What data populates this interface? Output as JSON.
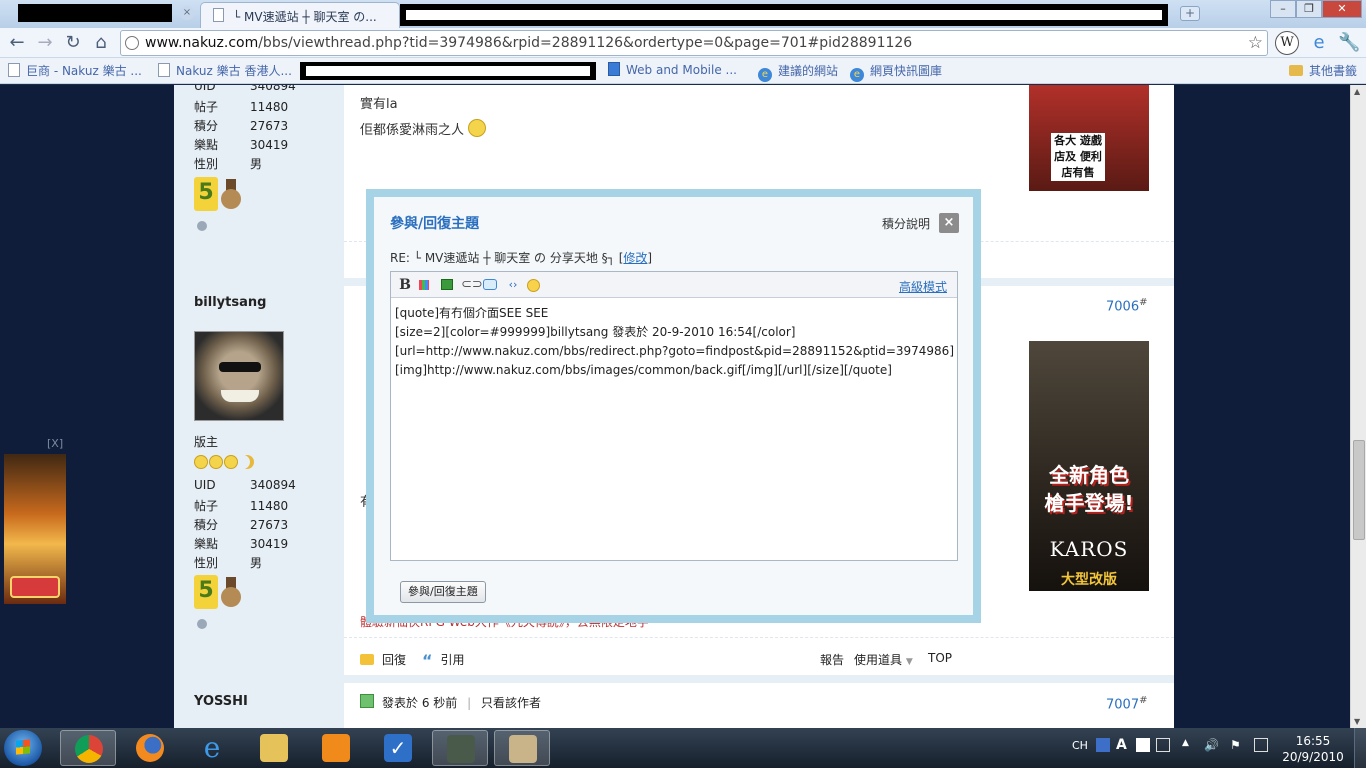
{
  "browser": {
    "tab_title": "└ MV速遞站 ┼ 聊天室 の...",
    "tab_close": "×",
    "new_tab": "+",
    "url_host": "www.nakuz.com",
    "url_path": "/bbs/viewthread.php?tid=3974986&rpid=28891126&ordertype=0&page=701#pid28891126",
    "window_controls": [
      "–",
      "❐",
      "✕"
    ],
    "extension_label": "W"
  },
  "bookmarks": {
    "items": [
      "巨商 - Nakuz 樂古 ...",
      "Nakuz 樂古 香港人...",
      "Web and Mobile ...",
      "建議的網站",
      "網頁快訊圖庫"
    ],
    "other": "其他書籤"
  },
  "posts": {
    "first": {
      "stats": [
        {
          "k": "UID",
          "v": "340894"
        },
        {
          "k": "帖子",
          "v": "11480"
        },
        {
          "k": "積分",
          "v": "27673"
        },
        {
          "k": "樂點",
          "v": "30419"
        },
        {
          "k": "性別",
          "v": "男"
        }
      ],
      "text_line1": "實有la",
      "text_line2": "佢都係愛淋雨之人"
    },
    "second": {
      "username": "billytsang",
      "rank": "版主",
      "post_number": "7006",
      "stats": [
        {
          "k": "UID",
          "v": "340894"
        },
        {
          "k": "帖子",
          "v": "11480"
        },
        {
          "k": "積分",
          "v": "27673"
        },
        {
          "k": "樂點",
          "v": "30419"
        },
        {
          "k": "性別",
          "v": "男"
        }
      ],
      "stray_char": "有",
      "promo": "體驗新仙俠RPG Web大作《九天傳說》，去無限定地字",
      "actions": {
        "reply": "回復",
        "quote": "引用",
        "report": "報告",
        "tools": "使用道具",
        "top": "TOP"
      }
    },
    "third": {
      "username": "YOSSHI",
      "posted": "發表於 6 秒前",
      "only_author": "只看該作者",
      "post_number": "7007"
    },
    "hash": "#"
  },
  "ads": {
    "top_right_text": "各大 遊戲店及 便利店有售",
    "karos_headline_1": "全新角色",
    "karos_headline_2": "槍手登場!",
    "karos_brand": "KAROS",
    "karos_sub": "大型改版",
    "left_close": "[X]"
  },
  "modal": {
    "title": "參與/回復主題",
    "help": "積分說明",
    "close": "×",
    "re_prefix": "RE: └ MV速遞站 ┼ 聊天室 の 分享天地 §┐",
    "re_edit": "修改",
    "advanced_mode": "高級模式",
    "toolbar_bold": "B",
    "editor_content": "[quote]有冇個介面SEE SEE\n[size=2][color=#999999]billytsang 發表於 20-9-2010 16:54[/color]\n[url=http://www.nakuz.com/bbs/redirect.php?goto=findpost&pid=28891152&ptid=3974986][img]http://www.nakuz.com/bbs/images/common/back.gif[/img][/url][/size][/quote]",
    "submit_label": "參與/回復主題"
  },
  "taskbar": {
    "input_lang": "CH",
    "time": "16:55",
    "date": "20/9/2010"
  }
}
